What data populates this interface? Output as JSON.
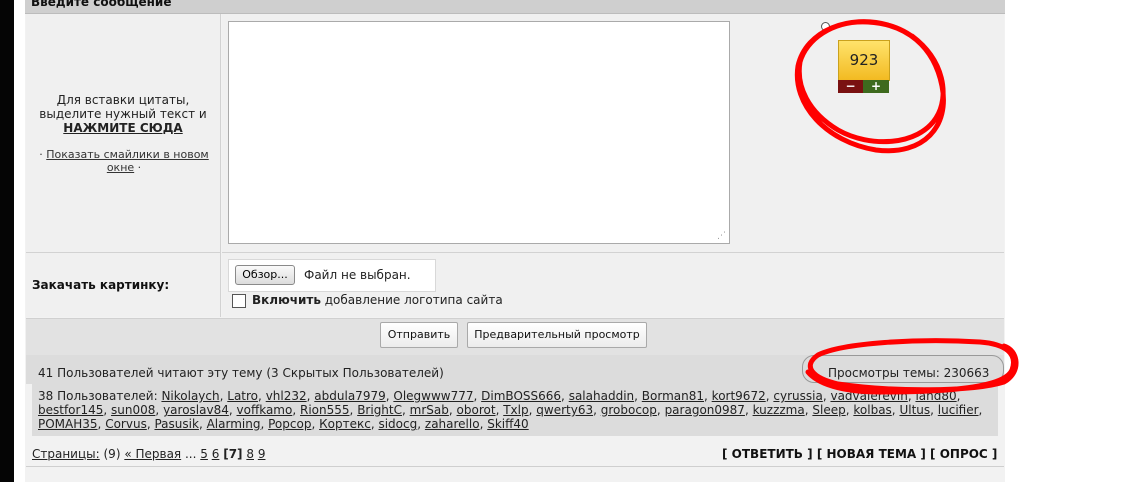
{
  "header": {
    "title": "Введите сообщение"
  },
  "quote_hint": {
    "line1": "Для вставки цитаты,",
    "line2": "выделите нужный текст и",
    "click": "НАЖМИТЕ СЮДА"
  },
  "smileys": {
    "bullet_left": "·",
    "link": "Показать смайлики в новом окне",
    "bullet_right": "·"
  },
  "message": {
    "value": ""
  },
  "rating": {
    "value": "923",
    "minus": "−",
    "plus": "+"
  },
  "upload": {
    "label": "Закачать картинку:",
    "browse": "Обзор...",
    "status": "Файл не выбран.",
    "logo_bold": "Включить",
    "logo_rest": " добавление логотипа сайта"
  },
  "actions": {
    "send": "Отправить",
    "preview": "Предварительный просмотр"
  },
  "readers": {
    "count_text": "41 Пользователей читают эту тему (3 Скрытых Пользователей)",
    "views_text": "Просмотры темы: 230663",
    "users_prefix": "38 Пользователей:",
    "users": [
      "Nikolaych",
      "Latro",
      "vhl232",
      "abdula7979",
      "Olegwww777",
      "DimBOSS666",
      "salahaddin",
      "Borman81",
      "kort9672",
      "cyrussia",
      "vadvalerevih",
      "land80",
      "bestfor145",
      "sun008",
      "yaroslav84",
      "voffkamo",
      "Rion555",
      "BrightC",
      "mrSab",
      "oborot",
      "Txlp",
      "qwerty63",
      "grobocop",
      "paragon0987",
      "kuzzzma",
      "Sleep",
      "kolbas",
      "Ultus",
      "lucifier",
      "РОМАН35",
      "Corvus",
      "Pasusik",
      "Alarming",
      "Popcop",
      "Кортекс",
      "sidocg",
      "zaharello",
      "Skiff40"
    ]
  },
  "pagination": {
    "label": "Страницы:",
    "total": "(9)",
    "first": "« Первая",
    "ellipsis": "...",
    "pages_before": [
      "5",
      "6"
    ],
    "current": "[7]",
    "pages_after": [
      "8",
      "9"
    ]
  },
  "topic_actions": {
    "reply": "[ ОТВЕТИТЬ ]",
    "new_topic": "[ НОВАЯ ТЕМА ]",
    "poll": "[ ОПРОС ]"
  },
  "annotation": {
    "color": "#ff0000"
  }
}
